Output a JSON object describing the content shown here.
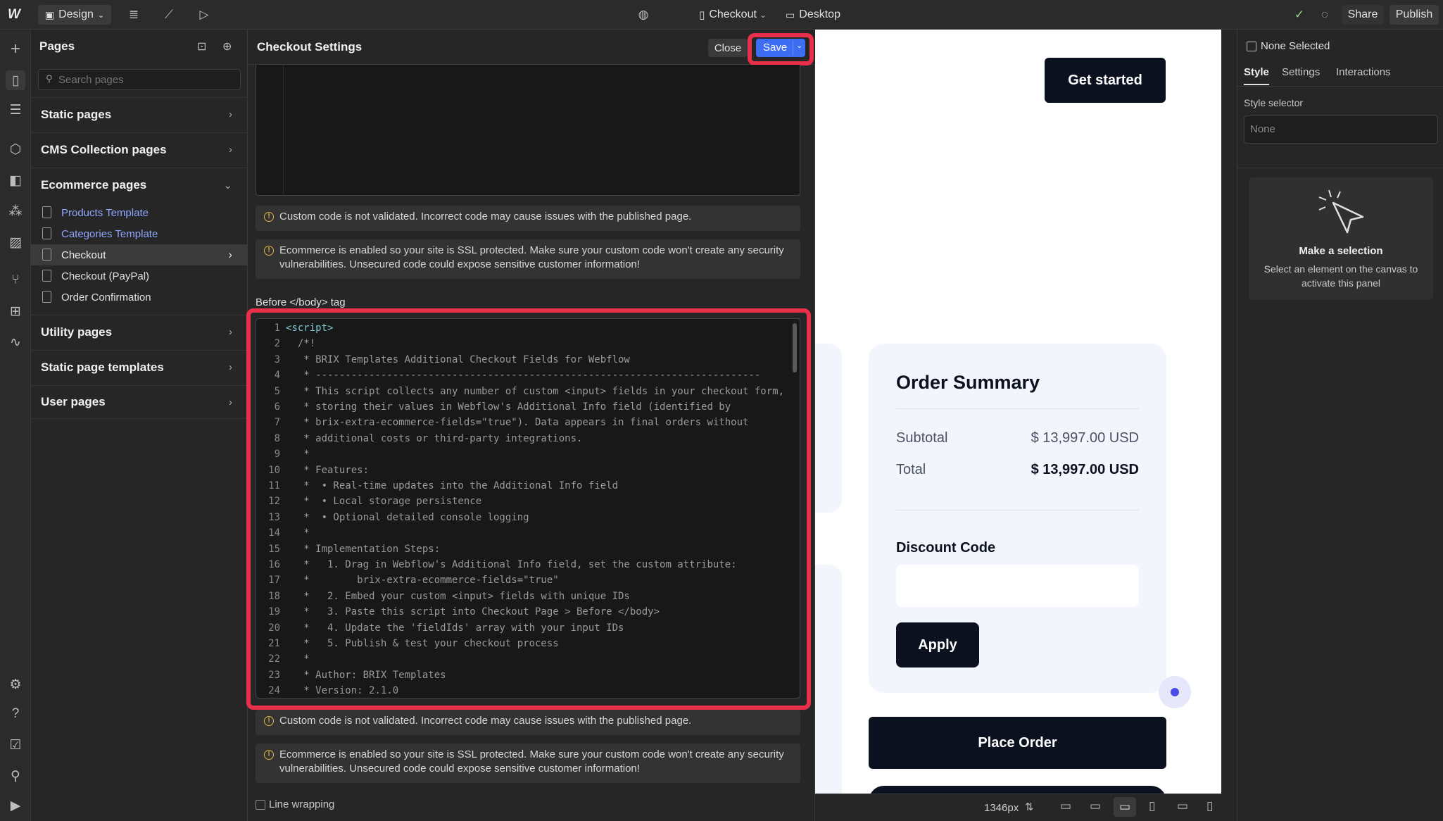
{
  "topbar": {
    "mode_label": "Design",
    "page_label": "Checkout",
    "breakpoint_label": "Desktop",
    "share_label": "Share",
    "publish_label": "Publish"
  },
  "pages_panel": {
    "title": "Pages",
    "search_placeholder": "Search pages",
    "static_pages": "Static pages",
    "cms_pages": "CMS Collection pages",
    "ecommerce_pages": "Ecommerce pages",
    "ecommerce_items": [
      {
        "label": "Products Template",
        "link": true
      },
      {
        "label": "Categories Template",
        "link": true
      },
      {
        "label": "Checkout",
        "link": false
      },
      {
        "label": "Checkout (PayPal)",
        "link": false
      },
      {
        "label": "Order Confirmation",
        "link": false
      }
    ],
    "utility_pages": "Utility pages",
    "static_templates": "Static page templates",
    "user_pages": "User pages"
  },
  "settings_panel": {
    "title": "Checkout Settings",
    "close_label": "Close",
    "save_label": "Save",
    "warning_validation": "Custom code is not validated. Incorrect code may cause issues with the published page.",
    "warning_ssl": "Ecommerce is enabled so your site is SSL protected. Make sure your custom code won't create any security vulnerabilities. Unsecured code could expose sensitive customer information!",
    "before_body_label": "Before </body> tag",
    "line_wrapping_label": "Line wrapping",
    "code_lines": [
      "<script>",
      "  /*!",
      "   * BRIX Templates Additional Checkout Fields for Webflow",
      "   * ---------------------------------------------------------------------------",
      "   * This script collects any number of custom <input> fields in your checkout form,",
      "   * storing their values in Webflow's Additional Info field (identified by",
      "   * brix-extra-ecommerce-fields=\"true\"). Data appears in final orders without",
      "   * additional costs or third-party integrations.",
      "   *",
      "   * Features:",
      "   *  • Real-time updates into the Additional Info field",
      "   *  • Local storage persistence",
      "   *  • Optional detailed console logging",
      "   *",
      "   * Implementation Steps:",
      "   *   1. Drag in Webflow's Additional Info field, set the custom attribute:",
      "   *        brix-extra-ecommerce-fields=\"true\"",
      "   *   2. Embed your custom <input> fields with unique IDs",
      "   *   3. Paste this script into Checkout Page > Before </body>",
      "   *   4. Update the 'fieldIds' array with your input IDs",
      "   *   5. Publish & test your checkout process",
      "   *",
      "   * Author: BRIX Templates",
      "   * Version: 2.1.0"
    ]
  },
  "canvas": {
    "get_started_label": "Get started",
    "order_summary_title": "Order Summary",
    "subtotal_label": "Subtotal",
    "subtotal_value": "$ 13,997.00 USD",
    "total_label": "Total",
    "total_value": "$ 13,997.00 USD",
    "discount_title": "Discount Code",
    "apply_label": "Apply",
    "place_order_label": "Place Order"
  },
  "bottombar": {
    "width_readout": "1346px"
  },
  "right_panel": {
    "none_selected_label": "None Selected",
    "tabs": [
      "Style",
      "Settings",
      "Interactions"
    ],
    "style_selector_label": "Style selector",
    "style_selector_placeholder": "None",
    "empty_title": "Make a selection",
    "empty_desc": "Select an element on the canvas to activate this panel"
  },
  "colors": {
    "accent_blue": "#3d6df2",
    "highlight_red": "#e8304a",
    "dark_navy": "#0c1120"
  }
}
